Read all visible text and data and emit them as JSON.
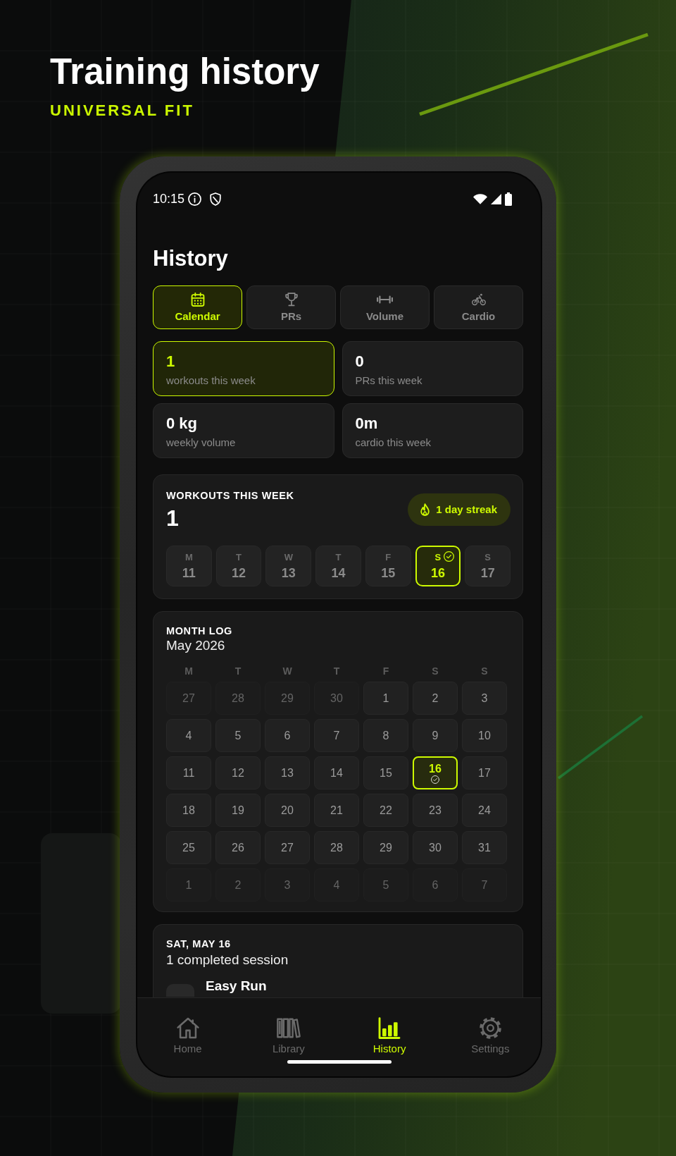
{
  "hero": {
    "title": "Training history",
    "subtitle": "UNIVERSAL FIT"
  },
  "status_bar": {
    "time": "10:15"
  },
  "screen": {
    "title": "History"
  },
  "tabs": [
    {
      "label": "Calendar",
      "selected": true
    },
    {
      "label": "PRs",
      "selected": false
    },
    {
      "label": "Volume",
      "selected": false
    },
    {
      "label": "Cardio",
      "selected": false
    }
  ],
  "stats": [
    {
      "value": "1",
      "label": "workouts this week",
      "highlighted": true
    },
    {
      "value": "0",
      "label": "PRs this week",
      "highlighted": false
    },
    {
      "value": "0 kg",
      "label": "weekly volume",
      "highlighted": false
    },
    {
      "value": "0m",
      "label": "cardio this week",
      "highlighted": false
    }
  ],
  "week": {
    "title": "WORKOUTS THIS WEEK",
    "count": "1",
    "streak": "1 day streak",
    "days": [
      {
        "weekday": "M",
        "date": "11",
        "selected": false,
        "completed": false
      },
      {
        "weekday": "T",
        "date": "12",
        "selected": false,
        "completed": false
      },
      {
        "weekday": "W",
        "date": "13",
        "selected": false,
        "completed": false
      },
      {
        "weekday": "T",
        "date": "14",
        "selected": false,
        "completed": false
      },
      {
        "weekday": "F",
        "date": "15",
        "selected": false,
        "completed": false
      },
      {
        "weekday": "S",
        "date": "16",
        "selected": true,
        "completed": true
      },
      {
        "weekday": "S",
        "date": "17",
        "selected": false,
        "completed": false
      }
    ]
  },
  "month": {
    "title": "MONTH LOG",
    "label": "May 2026",
    "weekdays": [
      "M",
      "T",
      "W",
      "T",
      "F",
      "S",
      "S"
    ],
    "weeks": [
      [
        {
          "date": "27",
          "in_month": false,
          "selected": false,
          "completed": false
        },
        {
          "date": "28",
          "in_month": false,
          "selected": false,
          "completed": false
        },
        {
          "date": "29",
          "in_month": false,
          "selected": false,
          "completed": false
        },
        {
          "date": "30",
          "in_month": false,
          "selected": false,
          "completed": false
        },
        {
          "date": "1",
          "in_month": true,
          "selected": false,
          "completed": false
        },
        {
          "date": "2",
          "in_month": true,
          "selected": false,
          "completed": false
        },
        {
          "date": "3",
          "in_month": true,
          "selected": false,
          "completed": false
        }
      ],
      [
        {
          "date": "4",
          "in_month": true,
          "selected": false,
          "completed": false
        },
        {
          "date": "5",
          "in_month": true,
          "selected": false,
          "completed": false
        },
        {
          "date": "6",
          "in_month": true,
          "selected": false,
          "completed": false
        },
        {
          "date": "7",
          "in_month": true,
          "selected": false,
          "completed": false
        },
        {
          "date": "8",
          "in_month": true,
          "selected": false,
          "completed": false
        },
        {
          "date": "9",
          "in_month": true,
          "selected": false,
          "completed": false
        },
        {
          "date": "10",
          "in_month": true,
          "selected": false,
          "completed": false
        }
      ],
      [
        {
          "date": "11",
          "in_month": true,
          "selected": false,
          "completed": false
        },
        {
          "date": "12",
          "in_month": true,
          "selected": false,
          "completed": false
        },
        {
          "date": "13",
          "in_month": true,
          "selected": false,
          "completed": false
        },
        {
          "date": "14",
          "in_month": true,
          "selected": false,
          "completed": false
        },
        {
          "date": "15",
          "in_month": true,
          "selected": false,
          "completed": false
        },
        {
          "date": "16",
          "in_month": true,
          "selected": true,
          "completed": true
        },
        {
          "date": "17",
          "in_month": true,
          "selected": false,
          "completed": false
        }
      ],
      [
        {
          "date": "18",
          "in_month": true,
          "selected": false,
          "completed": false
        },
        {
          "date": "19",
          "in_month": true,
          "selected": false,
          "completed": false
        },
        {
          "date": "20",
          "in_month": true,
          "selected": false,
          "completed": false
        },
        {
          "date": "21",
          "in_month": true,
          "selected": false,
          "completed": false
        },
        {
          "date": "22",
          "in_month": true,
          "selected": false,
          "completed": false
        },
        {
          "date": "23",
          "in_month": true,
          "selected": false,
          "completed": false
        },
        {
          "date": "24",
          "in_month": true,
          "selected": false,
          "completed": false
        }
      ],
      [
        {
          "date": "25",
          "in_month": true,
          "selected": false,
          "completed": false
        },
        {
          "date": "26",
          "in_month": true,
          "selected": false,
          "completed": false
        },
        {
          "date": "27",
          "in_month": true,
          "selected": false,
          "completed": false
        },
        {
          "date": "28",
          "in_month": true,
          "selected": false,
          "completed": false
        },
        {
          "date": "29",
          "in_month": true,
          "selected": false,
          "completed": false
        },
        {
          "date": "30",
          "in_month": true,
          "selected": false,
          "completed": false
        },
        {
          "date": "31",
          "in_month": true,
          "selected": false,
          "completed": false
        }
      ],
      [
        {
          "date": "1",
          "in_month": false,
          "selected": false,
          "completed": false
        },
        {
          "date": "2",
          "in_month": false,
          "selected": false,
          "completed": false
        },
        {
          "date": "3",
          "in_month": false,
          "selected": false,
          "completed": false
        },
        {
          "date": "4",
          "in_month": false,
          "selected": false,
          "completed": false
        },
        {
          "date": "5",
          "in_month": false,
          "selected": false,
          "completed": false
        },
        {
          "date": "6",
          "in_month": false,
          "selected": false,
          "completed": false
        },
        {
          "date": "7",
          "in_month": false,
          "selected": false,
          "completed": false
        }
      ]
    ]
  },
  "day_detail": {
    "title": "SAT, MAY 16",
    "summary": "1 completed session",
    "sessions": [
      {
        "name": "Easy Run"
      }
    ]
  },
  "nav": [
    {
      "label": "Home",
      "selected": false
    },
    {
      "label": "Library",
      "selected": false
    },
    {
      "label": "History",
      "selected": true
    },
    {
      "label": "Settings",
      "selected": false
    }
  ]
}
